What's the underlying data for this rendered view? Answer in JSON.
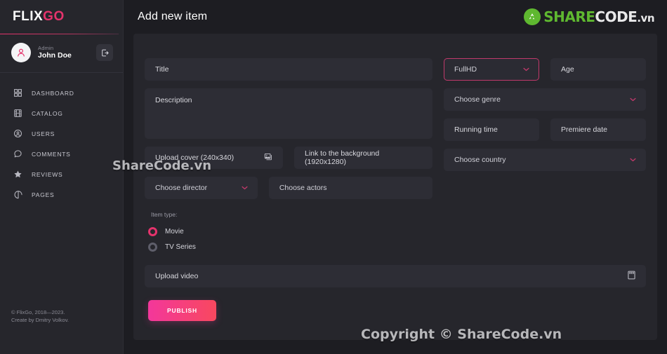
{
  "brand": {
    "part1": "FLIX",
    "part2": "GO"
  },
  "user": {
    "role": "Admin",
    "name": "John Doe",
    "logout_icon": "logout-icon"
  },
  "sidebar": {
    "items": [
      {
        "label": "DASHBOARD",
        "icon": "grid-icon"
      },
      {
        "label": "CATALOG",
        "icon": "film-icon"
      },
      {
        "label": "USERS",
        "icon": "user-circle-icon"
      },
      {
        "label": "COMMENTS",
        "icon": "comment-icon"
      },
      {
        "label": "REVIEWS",
        "icon": "star-icon"
      },
      {
        "label": "PAGES",
        "icon": "pages-icon"
      }
    ],
    "footer_line1": "© FlixGo, 2018—2023.",
    "footer_line2": "Create by Dmitry Volkov."
  },
  "header": {
    "title": "Add new item",
    "logo": {
      "share": "SHARE",
      "code": "CODE",
      "vn": ".vn"
    }
  },
  "form": {
    "title_placeholder": "Title",
    "description_placeholder": "Description",
    "quality_value": "FullHD",
    "age_placeholder": "Age",
    "genre_placeholder": "Choose genre",
    "running_time_placeholder": "Running time",
    "premiere_date_placeholder": "Premiere date",
    "cover_placeholder": "Upload cover (240x340)",
    "background_placeholder": "Link to the background (1920x1280)",
    "country_placeholder": "Choose country",
    "director_placeholder": "Choose director",
    "actors_placeholder": "Choose actors",
    "item_type_label": "Item type:",
    "item_types": [
      {
        "label": "Movie",
        "checked": true
      },
      {
        "label": "TV Series",
        "checked": false
      }
    ],
    "upload_video_placeholder": "Upload video",
    "publish_label": "PUBLISH"
  },
  "watermarks": {
    "middle": "ShareCode.vn",
    "bottom": "Copyright © ShareCode.vn"
  },
  "colors": {
    "accent": "#e5336c",
    "publish_from": "#f3379b",
    "publish_to": "#f8485f",
    "sidebar_bg": "#26262c",
    "page_bg": "#1d1d22",
    "field_bg": "#2d2d35",
    "logo_green": "#5fb830"
  }
}
